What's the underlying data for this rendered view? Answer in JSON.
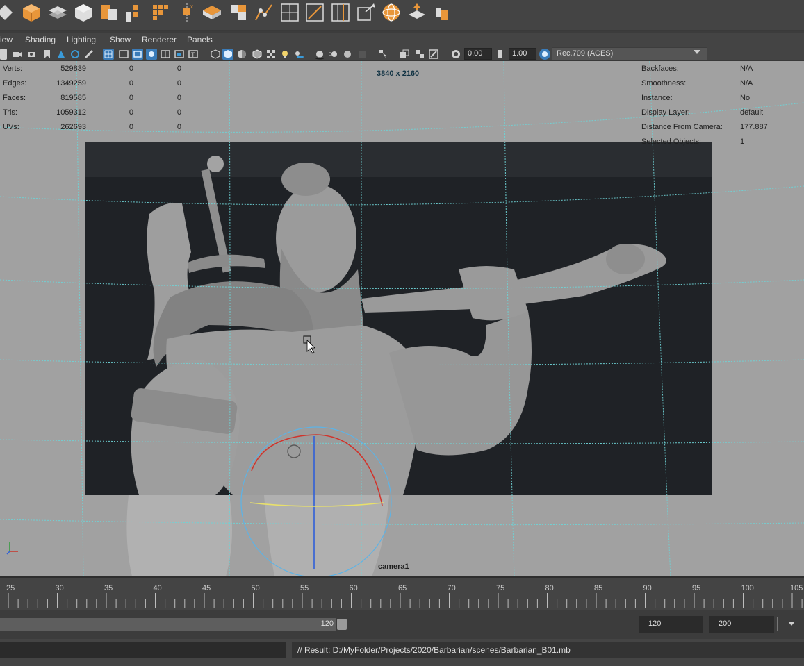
{
  "shelf": {
    "icons": [
      "diamond-icon",
      "poly-cube-icon",
      "poly-plane-stack-icon",
      "poly-cube-wire-icon",
      "combine-icon",
      "separate-icon",
      "grid-select-icon",
      "extract-icon",
      "bridge-icon",
      "boolean-icon",
      "bevel-icon",
      "grid-box-icon",
      "multicut-icon",
      "split-icon",
      "mirror-icon",
      "sphere-wire-icon",
      "merge-icon",
      "pin-icon"
    ]
  },
  "menu": {
    "view": "iew",
    "shading": "Shading",
    "lighting": "Lighting",
    "show": "Show",
    "renderer": "Renderer",
    "panels": "Panels"
  },
  "toolbar": {
    "exposure": "0.00",
    "gamma": "1.00",
    "color_space": "Rec.709 (ACES)"
  },
  "hud": {
    "resolution": "3840 x 2160",
    "camera_name": "camera1",
    "stats": [
      {
        "label": "Verts:",
        "value": "529839",
        "sel": "0",
        "comp": "0"
      },
      {
        "label": "Edges:",
        "value": "1349259",
        "sel": "0",
        "comp": "0"
      },
      {
        "label": "Faces:",
        "value": "819585",
        "sel": "0",
        "comp": "0"
      },
      {
        "label": "Tris:",
        "value": "1059312",
        "sel": "0",
        "comp": "0"
      },
      {
        "label": "UVs:",
        "value": "262693",
        "sel": "0",
        "comp": "0"
      }
    ],
    "info": [
      {
        "label": "Backfaces:",
        "value": "N/A"
      },
      {
        "label": "Smoothness:",
        "value": "N/A"
      },
      {
        "label": "Instance:",
        "value": "No"
      },
      {
        "label": "Display Layer:",
        "value": "default"
      },
      {
        "label": "Distance From Camera:",
        "value": "177.887"
      },
      {
        "label": "Selected Objects:",
        "value": "1"
      }
    ]
  },
  "timeline": {
    "ticks": [
      "25",
      "30",
      "35",
      "40",
      "45",
      "50",
      "55",
      "60",
      "65",
      "70",
      "75",
      "80",
      "85",
      "90",
      "95",
      "100",
      "105"
    ]
  },
  "range": {
    "end_value": "120",
    "anim_end": "120",
    "scene_end": "200"
  },
  "command": {
    "result": "// Result: D:/MyFolder/Projects/2020/Barbarian/scenes/Barbarian_B01.mb"
  },
  "colors": {
    "shelf_orange": "#e8963a",
    "viewport_bg": "#a1a1a1",
    "grid_cyan": "#6fd3d6",
    "toolbar_active": "#3a7bb8"
  }
}
